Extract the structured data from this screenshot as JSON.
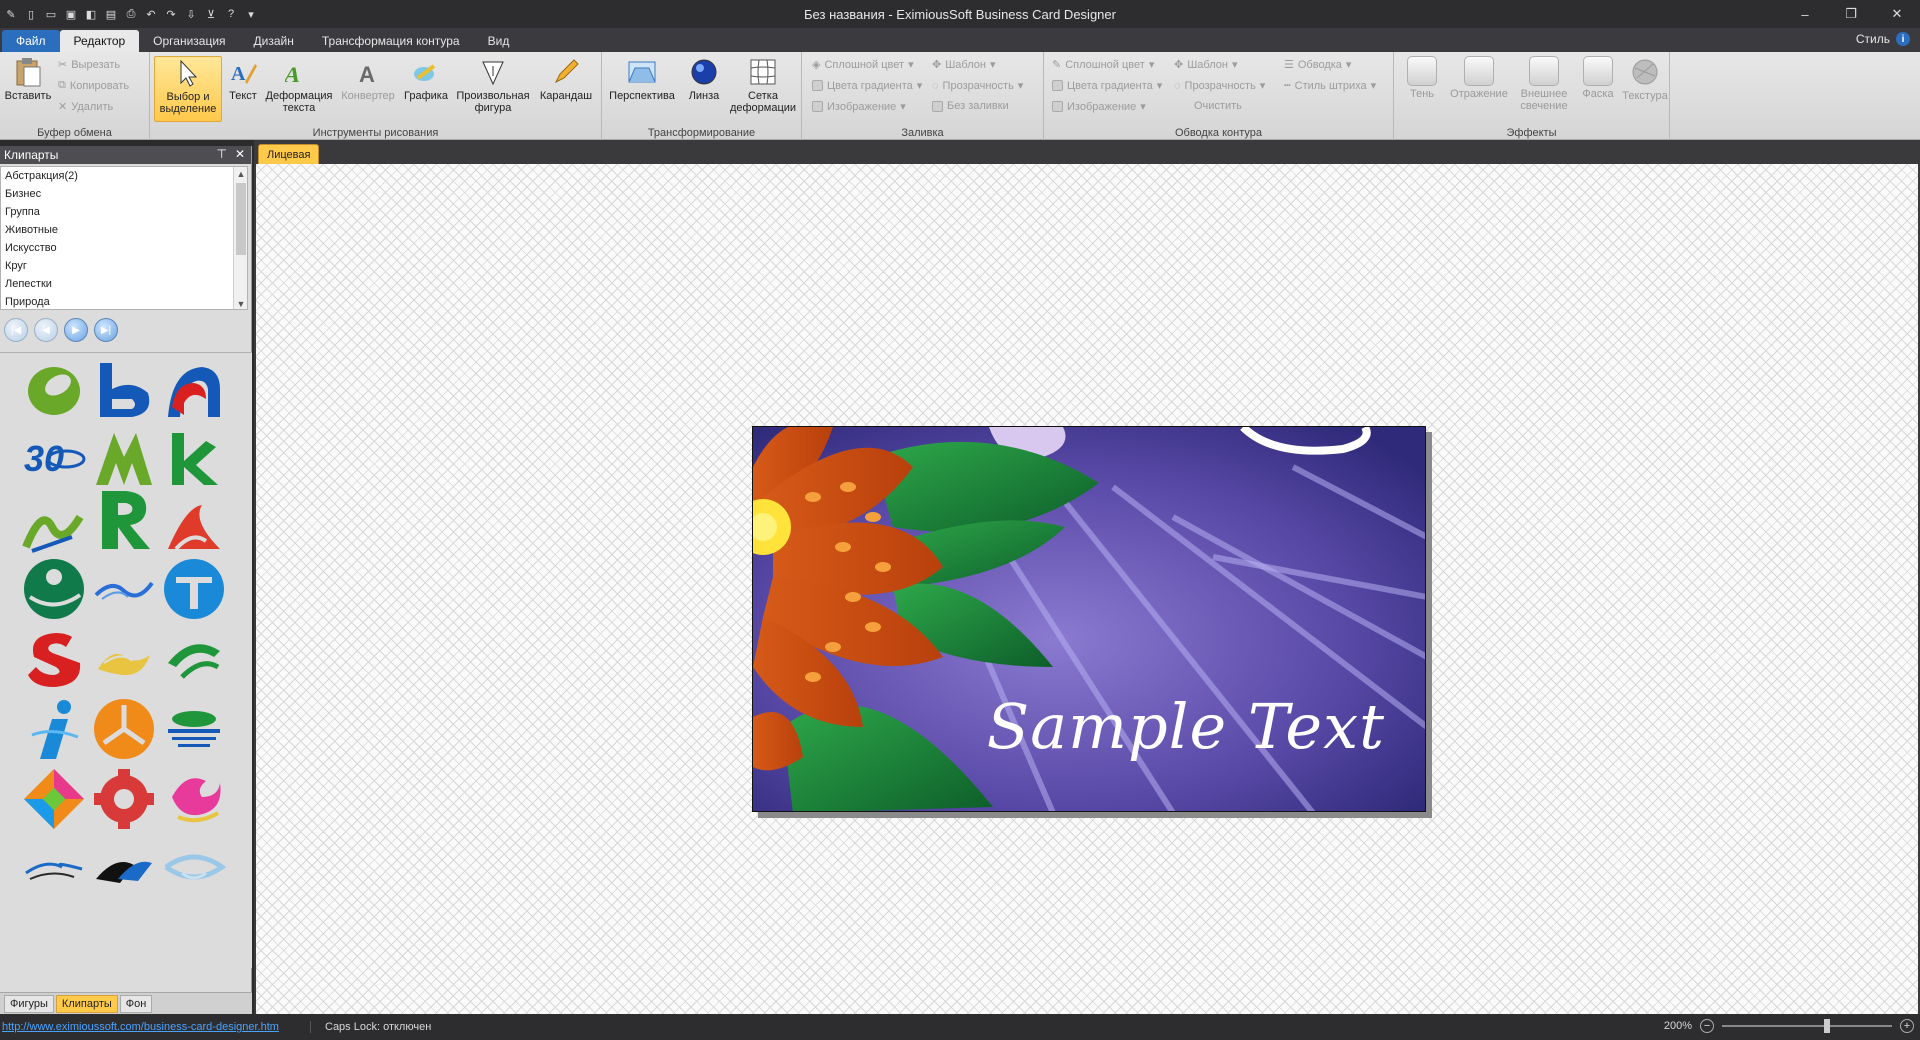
{
  "window": {
    "title": "Без названия - EximiousSoft Business Card Designer",
    "qat_icons": [
      "app-icon",
      "new-icon",
      "open-icon",
      "save-icon",
      "pdf-icon",
      "save-as-icon",
      "print-icon",
      "undo-icon",
      "redo-icon",
      "export-icon",
      "cart-icon",
      "help-icon",
      "customize-icon"
    ]
  },
  "tabs": {
    "file": "Файл",
    "items": [
      "Редактор",
      "Организация",
      "Дизайн",
      "Трансформация контура",
      "Вид"
    ],
    "active": "Редактор",
    "style": "Стиль"
  },
  "ribbon": {
    "clipboard": {
      "label": "Буфер обмена",
      "paste": "Вставить",
      "cut": "Вырезать",
      "copy": "Копировать",
      "delete": "Удалить"
    },
    "drawing": {
      "label": "Инструменты рисования",
      "select": "Выбор и выделение",
      "text": "Текст",
      "warp": "Деформация текста",
      "converter": "Конвертер",
      "graphics": "Графика",
      "freeform": "Произвольная фигура",
      "pencil": "Карандаш"
    },
    "transform": {
      "label": "Трансформирование",
      "perspective": "Перспектива",
      "lens": "Линза",
      "grid": "Сетка деформации"
    },
    "fill": {
      "label": "Заливка",
      "solid": "Сплошной цвет",
      "gradient": "Цвета градиента",
      "image": "Изображение",
      "pattern": "Шаблон",
      "transparency": "Прозрачность",
      "nofill": "Без заливки"
    },
    "outline": {
      "label": "Обводка контура",
      "solid": "Сплошной цвет",
      "gradient": "Цвета градиента",
      "image": "Изображение",
      "pattern": "Шаблон",
      "transparency": "Прозрачность",
      "clear": "Очистить",
      "stroke": "Обводка",
      "stroke_style": "Стиль штриха"
    },
    "effects": {
      "label": "Эффекты",
      "shadow": "Тень",
      "reflection": "Отражение",
      "glow": "Внешнее свечение",
      "bevel": "Фаска",
      "texture": "Текстура"
    }
  },
  "left_panel": {
    "title": "Клипарты",
    "categories": [
      "Абстракция(2)",
      "Бизнес",
      "Группа",
      "Животные",
      "Искусство",
      "Круг",
      "Лепестки",
      "Природа"
    ],
    "bottom_tabs": [
      "Фигуры",
      "Клипарты",
      "Фон"
    ],
    "active_tab": "Клипарты"
  },
  "document": {
    "tab": "Лицевая",
    "card_text": "Sample Text"
  },
  "status": {
    "link": "http://www.eximioussoft.com/business-card-designer.htm",
    "caps": "Caps Lock: отключен",
    "zoom": "200%",
    "zoom_fraction": 0.62
  },
  "colors": {
    "accent": "#2a6ebd",
    "selected": "#ffc94a",
    "card_bg": "#4e3f96"
  }
}
